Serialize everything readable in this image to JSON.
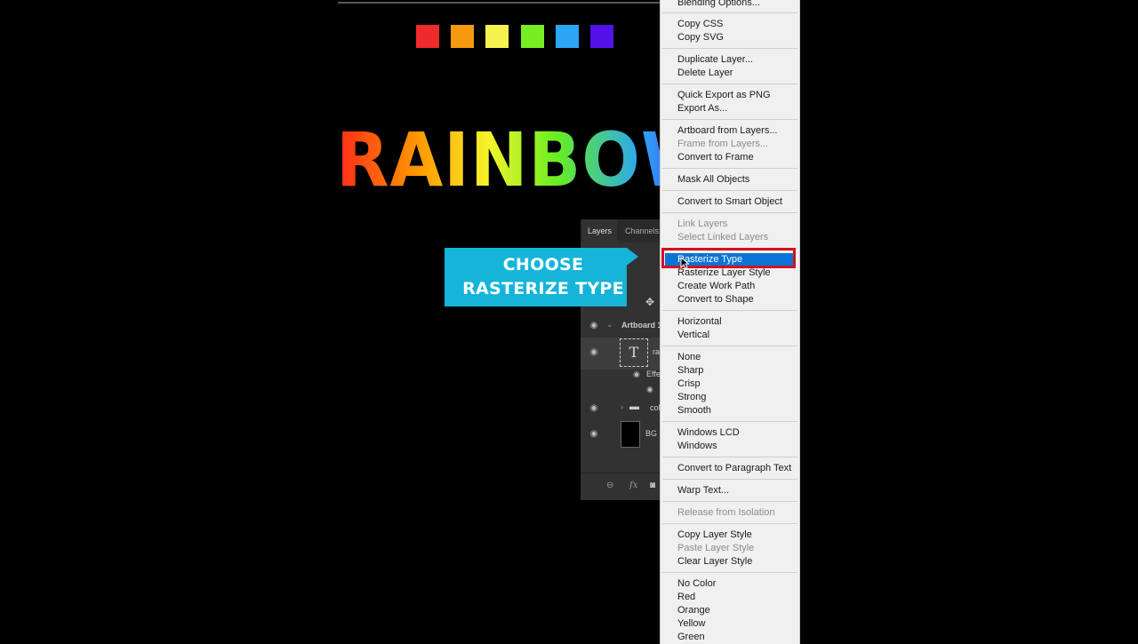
{
  "canvas": {
    "swatches": [
      {
        "name": "red",
        "color": "#ee2a2a"
      },
      {
        "name": "orange",
        "color": "#f59a10"
      },
      {
        "name": "yellow",
        "color": "#f5f250"
      },
      {
        "name": "green",
        "color": "#77ee22"
      },
      {
        "name": "blue",
        "color": "#2aa6f5"
      },
      {
        "name": "purple",
        "color": "#5512e8"
      }
    ],
    "headline": "RAINBOW"
  },
  "callout": {
    "line1": "CHOOSE",
    "line2": "RASTERIZE TYPE",
    "color": "#14b5d8"
  },
  "layers_panel": {
    "tabs": [
      "Layers",
      "Channels"
    ],
    "rows": {
      "artboard": "Artboard 1",
      "text_layer": "ra",
      "effects": "Effe",
      "group": "col",
      "bg": "BG"
    },
    "footer_icons": [
      "link-icon",
      "fx-icon",
      "mask-icon"
    ]
  },
  "context_menu": {
    "highlight_color": "#0a74d6",
    "annotation_color": "#d6101e",
    "items": {
      "blending_options": "Blending Options...",
      "copy_css": "Copy CSS",
      "copy_svg": "Copy SVG",
      "duplicate_layer": "Duplicate Layer...",
      "delete_layer": "Delete Layer",
      "quick_export_png": "Quick Export as PNG",
      "export_as": "Export As...",
      "artboard_from_layers": "Artboard from Layers...",
      "frame_from_layers": "Frame from Layers...",
      "convert_to_frame": "Convert to Frame",
      "mask_all_objects": "Mask All Objects",
      "convert_smart_object": "Convert to Smart Object",
      "link_layers": "Link Layers",
      "select_linked_layers": "Select Linked Layers",
      "rasterize_type": "Rasterize Type",
      "rasterize_layer_style": "Rasterize Layer Style",
      "create_work_path": "Create Work Path",
      "convert_to_shape": "Convert to Shape",
      "horizontal": "Horizontal",
      "vertical": "Vertical",
      "aa_none": "None",
      "aa_sharp": "Sharp",
      "aa_crisp": "Crisp",
      "aa_strong": "Strong",
      "aa_smooth": "Smooth",
      "windows_lcd": "Windows LCD",
      "windows": "Windows",
      "convert_paragraph_text": "Convert to Paragraph Text",
      "warp_text": "Warp Text...",
      "release_isolation": "Release from Isolation",
      "copy_layer_style": "Copy Layer Style",
      "paste_layer_style": "Paste Layer Style",
      "clear_layer_style": "Clear Layer Style",
      "no_color": "No Color",
      "red": "Red",
      "orange": "Orange",
      "yellow": "Yellow",
      "green": "Green"
    }
  }
}
